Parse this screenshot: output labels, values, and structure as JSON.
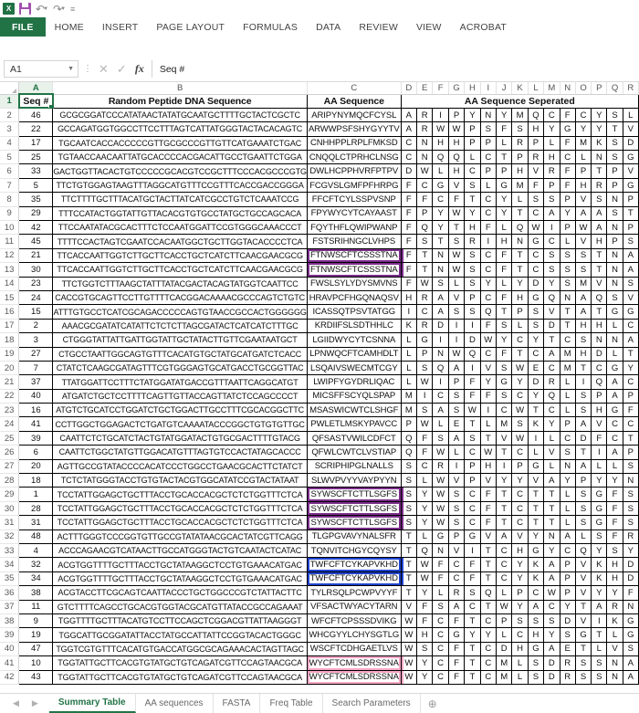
{
  "app": {
    "quick_access": {
      "excel_logo": "excel-logo-icon",
      "save": "save-icon",
      "undo": "undo-icon",
      "redo": "redo-icon",
      "customize": "customize-qat-icon"
    },
    "ribbon_tabs": [
      "FILE",
      "HOME",
      "INSERT",
      "PAGE LAYOUT",
      "FORMULAS",
      "DATA",
      "REVIEW",
      "VIEW",
      "ACROBAT"
    ],
    "formula_bar": {
      "name_box": "A1",
      "cancel_icon": "cancel-icon",
      "accept_icon": "accept-icon",
      "fx_icon": "insert-function-icon",
      "value": "Seq #"
    }
  },
  "grid": {
    "column_letters": [
      "A",
      "B",
      "C",
      "D",
      "E",
      "F",
      "G",
      "H",
      "I",
      "J",
      "K",
      "L",
      "M",
      "N",
      "O",
      "P",
      "Q",
      "R"
    ],
    "active_column": "A",
    "active_row": 1,
    "row_numbers": [
      1,
      2,
      3,
      4,
      5,
      6,
      7,
      8,
      9,
      10,
      11,
      12,
      13,
      14,
      15,
      16,
      17,
      18,
      19,
      20,
      21,
      22,
      23,
      24,
      25,
      26,
      27,
      28,
      29,
      30,
      31,
      32,
      33,
      34,
      35,
      36,
      37,
      38,
      39,
      40,
      41,
      42
    ],
    "headers": {
      "seq": "Seq #",
      "dna": "Random Peptide DNA Sequence",
      "aa": "AA Sequence",
      "separated": "AA Sequence Seperated"
    },
    "highlight_colors": {
      "purple": "#7b2d8b",
      "blue": "#1f44d0",
      "pink": "#f9a7c6",
      "selection": "#217346"
    },
    "rows": [
      {
        "seq": "46",
        "dna": "GCGCGGATCCCATATAACTATATGCAATGCTTTTGCTACTCGCTC",
        "aa": "ARIPYNYMQCFCYSL",
        "hl": null
      },
      {
        "seq": "22",
        "dna": "GCCAGATGGTGGCCTTCCTTTAGTCATTATGGGTACTACACAGTC",
        "aa": "ARWWPSFSHYGYYTV",
        "hl": null
      },
      {
        "seq": "17",
        "dna": "TGCAATCACCACCCCCGTTGCGCCCGTTGTTCATGAAATCTGAC",
        "aa": "CNHHPPLRPLFMKSD",
        "hl": null
      },
      {
        "seq": "25",
        "dna": "TGTAACCAACAATTATGCACCCCACGACATTGCCTGAATTCTGGA",
        "aa": "CNQQLCTPRHCLNSG",
        "hl": null
      },
      {
        "seq": "33",
        "dna": "GACTGGTTACACTGTCCCCCGCACGTCCGCTTTCCCACGCCCGTG",
        "aa": "DWLHCPPHVRFPTPV",
        "hl": null
      },
      {
        "seq": "5",
        "dna": "TTCTGTGGAGTAAGTTTAGGCATGTTTCCGTTTCACCGACCGGGA",
        "aa": "FCGVSLGMFPFHRPG",
        "hl": null
      },
      {
        "seq": "35",
        "dna": "TTCTTTTGCTTTACATGCTACTTATCATCGCCTGTCTCAAATCCG",
        "aa": "FFCFTCYLSSPVSNP",
        "hl": null
      },
      {
        "seq": "29",
        "dna": "TTTCCATACTGGTATTGTTACACGTGTGCCTATGCTGCCAGCACA",
        "aa": "FPYWYCYTCAYAAST",
        "hl": null
      },
      {
        "seq": "42",
        "dna": "TTCCAATATACGCACTTTCTCCAATGGATTCCGTGGGCAAACCCT",
        "aa": "FQYTHFLQWIPWANP",
        "hl": null
      },
      {
        "seq": "45",
        "dna": "TTTTCCACTAGTCGAATCCACAATGGCTGCTTGGTACACCCCTCA",
        "aa": "FSTSRIHNGCLVHPS",
        "hl": null
      },
      {
        "seq": "21",
        "dna": "TTCACCAATTGGTCTTGCTTCACCTGCTCATCTTCAACGAACGCG",
        "aa": "FTNWSCFTCSSSTNA",
        "hl": "purple"
      },
      {
        "seq": "30",
        "dna": "TTCACCAATTGGTCTTGCTTCACCTGCTCATCTTCAACGAACGCG",
        "aa": "FTNWSCFTCSSSTNA",
        "hl": "purple"
      },
      {
        "seq": "23",
        "dna": "TTCTGGTCTTTAAGCTATTTATACGACTACAGTATGGTCAATTCC",
        "aa": "FWSLSYLYDYSMVNS",
        "hl": null
      },
      {
        "seq": "24",
        "dna": "CACCGTGCAGTTCCTTGTTTTCACGGACAAAACGCCCAGTCTGTC",
        "aa": "HRAVPCFHGQNAQSV",
        "hl": null
      },
      {
        "seq": "15",
        "dna": "ATTTGTGCCTCATCGCAGACCCCCAGTGTAACCGCCACTGGGGGG",
        "aa": "ICASSQTPSVTATGG",
        "hl": null
      },
      {
        "seq": "2",
        "dna": "AAACGCGATATCATATTCTCTCTTAGCGATACTCATCATCTTTGC",
        "aa": "KRDIIFSLSDTHHLC",
        "hl": null
      },
      {
        "seq": "3",
        "dna": "CTGGGTATTATTGATTGGTATTGCTATACTTGTTCGAATAATGCT",
        "aa": "LGIIDWYCYTCSNNA",
        "hl": null
      },
      {
        "seq": "27",
        "dna": "CTGCCTAATTGGCAGTGTTTCACATGTGCTATGCATGATCTCACC",
        "aa": "LPNWQCFTCAMHDLT",
        "hl": null
      },
      {
        "seq": "7",
        "dna": "CTATCTCAAGCGATAGTTTCGTGGGAGTGCATGACCTGCGGTTAC",
        "aa": "LSQAIVSWECMTCGY",
        "hl": null
      },
      {
        "seq": "37",
        "dna": "TTATGGATTCCTTTCTATGGATATGACCGTTTAATTCAGGCATGT",
        "aa": "LWIPFYGYDRLIQAC",
        "hl": null
      },
      {
        "seq": "40",
        "dna": "ATGATCTGCTCCTTTTCAGTTGTTACCAGTTATCTCCAGCCCCT",
        "aa": "MICSFFSCYQLSPAP",
        "hl": null
      },
      {
        "seq": "16",
        "dna": "ATGTCTGCATCCTGGATCTGCTGGACTTGCCTTTCGCACGGCTTC",
        "aa": "MSASWICWTCLSHGF",
        "hl": null
      },
      {
        "seq": "41",
        "dna": "CCTTGGCTGGAGACTCTGATGTCAAAATACCCGGCTGTGTGTTGC",
        "aa": "PWLETLMSKYPAVCC",
        "hl": null
      },
      {
        "seq": "39",
        "dna": "CAATTCTCTGCATCTACTGTATGGATACTGTGCGACTTTTGTACG",
        "aa": "QFSASTVWILCDFCT",
        "hl": null
      },
      {
        "seq": "6",
        "dna": "CAATTCTGGCTATGTTGGACATGTTTAGTGTCCACTATAGCACCC",
        "aa": "QFWLCWTCLVSTIAP",
        "hl": null
      },
      {
        "seq": "20",
        "dna": "AGTTGCCGTATACCCCACATCCCTGGCCTGAACGCACTTCTATCT",
        "aa": "SCRIPHIPGLNALLS",
        "hl": null
      },
      {
        "seq": "18",
        "dna": "TCTCTATGGGTACCTGTGTACTACGTGGCATATCCGTACTATAAT",
        "aa": "SLWVPVYYVAYPYYN",
        "hl": null
      },
      {
        "seq": "1",
        "dna": "TCCTATTGGAGCTGCTTTACCTGCACCACGCTCTCTGGTTTCTCA",
        "aa": "SYWSCFTCTTLSGFS",
        "hl": "purple"
      },
      {
        "seq": "28",
        "dna": "TCCTATTGGAGCTGCTTTACCTGCACCACGCTCTCTGGTTTCTCA",
        "aa": "SYWSCFTCTTLSGFS",
        "hl": "purple"
      },
      {
        "seq": "31",
        "dna": "TCCTATTGGAGCTGCTTTACCTGCACCACGCTCTCTGGTTTCTCA",
        "aa": "SYWSCFTCTTLSGFS",
        "hl": "purple"
      },
      {
        "seq": "48",
        "dna": "ACTTTGGGTCCCGGTGTTGCCGTATATAACGCACTATCGTTCAGG",
        "aa": "TLGPGVAVYNALSFR",
        "hl": null
      },
      {
        "seq": "4",
        "dna": "ACCCAGAACGTCATAACTTGCCATGGGTACTGTCAATACTCATAC",
        "aa": "TQNVITCHGYCQYSY",
        "hl": null
      },
      {
        "seq": "32",
        "dna": "ACGTGGTTTTGCTTTACCTGCTATAAGGCTCCTGTGAAACATGAC",
        "aa": "TWFCFTCYKAPVKHD",
        "hl": "blue"
      },
      {
        "seq": "34",
        "dna": "ACGTGGTTTTGCTTTACCTGCTATAAGGCTCCTGTGAAACATGAC",
        "aa": "TWFCFTCYKAPVKHD",
        "hl": "blue"
      },
      {
        "seq": "38",
        "dna": "ACGTACCTTCGCAGTCAATTACCCTGCTGGCCCGTCTATTACTTC",
        "aa": "TYLRSQLPCWPVYYF",
        "hl": null
      },
      {
        "seq": "11",
        "dna": "GTCTTTTCAGCCTGCACGTGGTACGCATGTTATACCGCCAGAAAT",
        "aa": "VFSACTWYACYTARN",
        "hl": null
      },
      {
        "seq": "9",
        "dna": "TGGTTTTGCTTTACATGTCCTTCCAGCTCGGACGTTATTAAGGGT",
        "aa": "WFCFTCPSSSDVIKG",
        "hl": null
      },
      {
        "seq": "19",
        "dna": "TGGCATTGCGGATATTACCTATGCCATTATTCCGGTACACTGGGC",
        "aa": "WHCGYYLCHYSGTLG",
        "hl": null
      },
      {
        "seq": "47",
        "dna": "TGGTCGTGTTTCACATGTGACCATGGCGCAGAAACACTAGTTAGC",
        "aa": "WSCFTCDHGAETLVS",
        "hl": null
      },
      {
        "seq": "10",
        "dna": "TGGTATTGCTTCACGTGTATGCTGTCAGATCGTTCCAGTAACGCA",
        "aa": "WYCFTCMLSDRSSNA",
        "hl": "pink"
      },
      {
        "seq": "43",
        "dna": "TGGTATTGCTTCACGTGTATGCTGTCAGATCGTTCCAGTAACGCA",
        "aa": "WYCFTCMLSDRSSNA",
        "hl": "pink"
      }
    ]
  },
  "sheet_tabs": {
    "nav_prev": "prev-sheet-icon",
    "nav_next": "next-sheet-icon",
    "tabs": [
      "Summary Table",
      "AA sequences",
      "FASTA",
      "Freq Table",
      "Search Parameters"
    ],
    "active": "Summary Table",
    "add_sheet": "add-sheet-icon"
  }
}
